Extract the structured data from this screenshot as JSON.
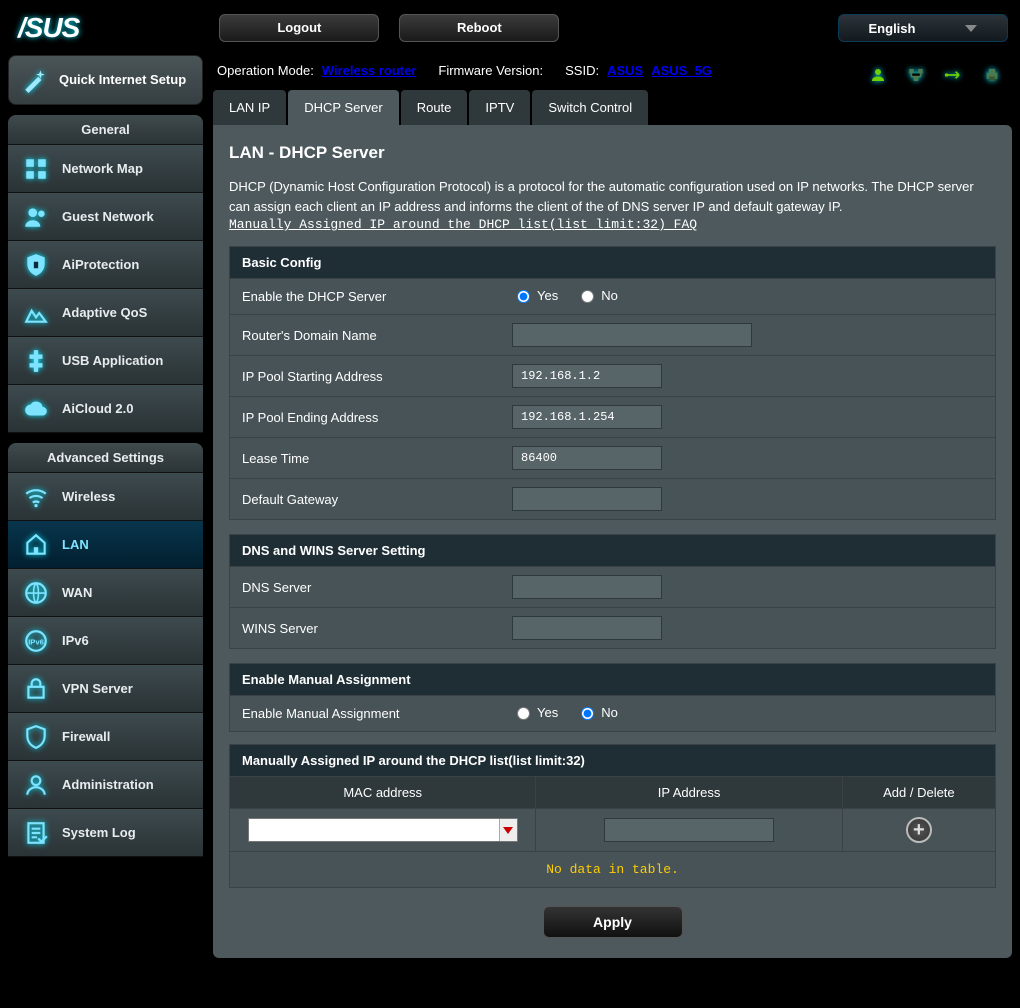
{
  "top": {
    "logo": "/SUS",
    "logout": "Logout",
    "reboot": "Reboot",
    "language": "English"
  },
  "status": {
    "mode_label": "Operation Mode:",
    "mode_value": "Wireless router",
    "fw_label": "Firmware Version:",
    "ssid_label": "SSID:",
    "ssid1": "ASUS",
    "ssid2": "ASUS_5G"
  },
  "sidebar": {
    "qis": "Quick Internet Setup",
    "general_header": "General",
    "general": [
      "Network Map",
      "Guest Network",
      "AiProtection",
      "Adaptive QoS",
      "USB Application",
      "AiCloud 2.0"
    ],
    "advanced_header": "Advanced Settings",
    "advanced": [
      "Wireless",
      "LAN",
      "WAN",
      "IPv6",
      "VPN Server",
      "Firewall",
      "Administration",
      "System Log"
    ],
    "active": "LAN"
  },
  "tabs": [
    "LAN IP",
    "DHCP Server",
    "Route",
    "IPTV",
    "Switch Control"
  ],
  "tab_active": "DHCP Server",
  "page": {
    "title": "LAN - DHCP Server",
    "desc": "DHCP (Dynamic Host Configuration Protocol) is a protocol for the automatic configuration used on IP networks. The DHCP server can assign each client an IP address and informs the client of the of DNS server IP and default gateway IP.",
    "faq": "Manually Assigned IP around the DHCP list(list limit:32) FAQ",
    "sections": {
      "basic": {
        "header": "Basic Config",
        "rows": {
          "enable": {
            "label": "Enable the DHCP Server",
            "value": "Yes"
          },
          "domain": {
            "label": "Router's Domain Name",
            "value": ""
          },
          "pool_start": {
            "label": "IP Pool Starting Address",
            "value": "192.168.1.2"
          },
          "pool_end": {
            "label": "IP Pool Ending Address",
            "value": "192.168.1.254"
          },
          "lease": {
            "label": "Lease Time",
            "value": "86400"
          },
          "gateway": {
            "label": "Default Gateway",
            "value": ""
          }
        }
      },
      "dns": {
        "header": "DNS and WINS Server Setting",
        "rows": {
          "dns": {
            "label": "DNS Server",
            "value": ""
          },
          "wins": {
            "label": "WINS Server",
            "value": ""
          }
        }
      },
      "manual": {
        "header": "Enable Manual Assignment",
        "rows": {
          "enable": {
            "label": "Enable Manual Assignment",
            "value": "No"
          }
        }
      },
      "table": {
        "header": "Manually Assigned IP around the DHCP list(list limit:32)",
        "cols": [
          "MAC address",
          "IP Address",
          "Add / Delete"
        ],
        "empty": "No data in table."
      }
    },
    "yes": "Yes",
    "no": "No",
    "apply": "Apply"
  }
}
